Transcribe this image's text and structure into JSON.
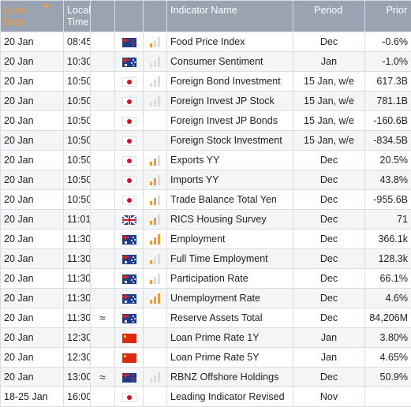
{
  "header": {
    "local_date": "Local Date",
    "local_time": "Local Time",
    "col3": "",
    "col4": "",
    "col5": "",
    "indicator": "Indicator Name",
    "period": "Period",
    "prior": "Prior"
  },
  "colors": {
    "header_bg": "#9aa3b2",
    "sort_accent": "#f29a3a",
    "volatility_on": "#f29a3a",
    "volatility_off": "#dcdcdc"
  },
  "rows": [
    {
      "date": "20 Jan",
      "time": "08:45",
      "prelim": "",
      "flag": "nz-flag-icon",
      "volatility": 1,
      "name": "Food Price Index",
      "period": "Dec",
      "prior": "-0.6%"
    },
    {
      "date": "20 Jan",
      "time": "10:30",
      "prelim": "",
      "flag": "au-flag-icon",
      "volatility": 0,
      "name": "Consumer Sentiment",
      "period": "Jan",
      "prior": "-1.0%"
    },
    {
      "date": "20 Jan",
      "time": "10:50",
      "prelim": "",
      "flag": "jp-flag-icon",
      "volatility": 0,
      "name": "Foreign Bond Investment",
      "period": "15 Jan, w/e",
      "prior": "617.3B"
    },
    {
      "date": "20 Jan",
      "time": "10:50",
      "prelim": "",
      "flag": "jp-flag-icon",
      "volatility": 0,
      "name": "Foreign Invest JP Stock",
      "period": "15 Jan, w/e",
      "prior": "781.1B"
    },
    {
      "date": "20 Jan",
      "time": "10:50",
      "prelim": "",
      "flag": "jp-flag-icon",
      "volatility": -1,
      "name": "Foreign Invest JP Bonds",
      "period": "15 Jan, w/e",
      "prior": "-160.6B"
    },
    {
      "date": "20 Jan",
      "time": "10:50",
      "prelim": "",
      "flag": "jp-flag-icon",
      "volatility": -1,
      "name": "Foreign Stock Investment",
      "period": "15 Jan, w/e",
      "prior": "-834.5B"
    },
    {
      "date": "20 Jan",
      "time": "10:50",
      "prelim": "",
      "flag": "jp-flag-icon",
      "volatility": 2,
      "name": "Exports YY",
      "period": "Dec",
      "prior": "20.5%"
    },
    {
      "date": "20 Jan",
      "time": "10:50",
      "prelim": "",
      "flag": "jp-flag-icon",
      "volatility": 2,
      "name": "Imports YY",
      "period": "Dec",
      "prior": "43.8%"
    },
    {
      "date": "20 Jan",
      "time": "10:50",
      "prelim": "",
      "flag": "jp-flag-icon",
      "volatility": 2,
      "name": "Trade Balance Total Yen",
      "period": "Dec",
      "prior": "-955.6B"
    },
    {
      "date": "20 Jan",
      "time": "11:01",
      "prelim": "",
      "flag": "gb-flag-icon",
      "volatility": 2,
      "name": "RICS Housing Survey",
      "period": "Dec",
      "prior": "71"
    },
    {
      "date": "20 Jan",
      "time": "11:30",
      "prelim": "",
      "flag": "au-flag-icon",
      "volatility": 3,
      "name": "Employment",
      "period": "Dec",
      "prior": "366.1k"
    },
    {
      "date": "20 Jan",
      "time": "11:30",
      "prelim": "",
      "flag": "au-flag-icon",
      "volatility": 1,
      "name": "Full Time Employment",
      "period": "Dec",
      "prior": "128.3k"
    },
    {
      "date": "20 Jan",
      "time": "11:30",
      "prelim": "",
      "flag": "au-flag-icon",
      "volatility": 1,
      "name": "Participation Rate",
      "period": "Dec",
      "prior": "66.1%"
    },
    {
      "date": "20 Jan",
      "time": "11:30",
      "prelim": "",
      "flag": "au-flag-icon",
      "volatility": 3,
      "name": "Unemployment Rate",
      "period": "Dec",
      "prior": "4.6%"
    },
    {
      "date": "20 Jan",
      "time": "11:30",
      "prelim": "≈",
      "flag": "au-flag-icon",
      "volatility": -1,
      "name": "Reserve Assets Total",
      "period": "Dec",
      "prior": "84,206M"
    },
    {
      "date": "20 Jan",
      "time": "12:30",
      "prelim": "",
      "flag": "cn-flag-icon",
      "volatility": -1,
      "name": "Loan Prime Rate 1Y",
      "period": "Jan",
      "prior": "3.80%"
    },
    {
      "date": "20 Jan",
      "time": "12:30",
      "prelim": "",
      "flag": "cn-flag-icon",
      "volatility": -1,
      "name": "Loan Prime Rate 5Y",
      "period": "Jan",
      "prior": "4.65%"
    },
    {
      "date": "20 Jan",
      "time": "13:00",
      "prelim": "≈",
      "flag": "nz-flag-icon",
      "volatility": 0,
      "name": "RBNZ Offshore Holdings",
      "period": "Dec",
      "prior": "50.9%"
    },
    {
      "date": "18-25 Jan",
      "time": "16:00",
      "prelim": "",
      "flag": "jp-flag-icon",
      "volatility": -1,
      "name": "Leading Indicator Revised",
      "period": "Nov",
      "prior": ""
    }
  ]
}
